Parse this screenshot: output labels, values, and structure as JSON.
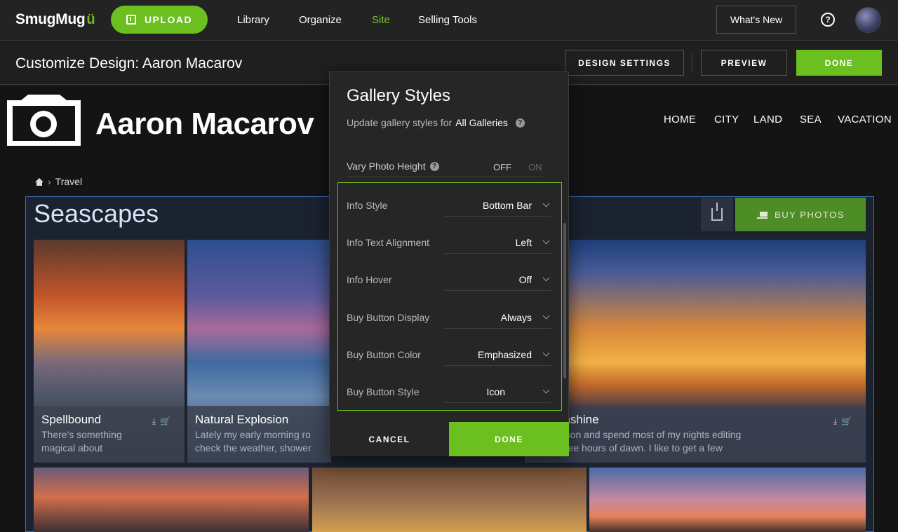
{
  "topbar": {
    "logo": "SmugMug",
    "upload_label": "UPLOAD",
    "nav": [
      "Library",
      "Organize",
      "Site",
      "Selling Tools"
    ],
    "active_nav": "Site",
    "whats_new": "What's New",
    "help": "?"
  },
  "subbar": {
    "title": "Customize Design: Aaron Macarov",
    "design_settings": "DESIGN SETTINGS",
    "preview": "PREVIEW",
    "done": "DONE"
  },
  "site": {
    "name": "Aaron Macarov",
    "nav": [
      "HOME",
      "CITY",
      "LAND",
      "SEA",
      "VACATION"
    ],
    "breadcrumb": "Travel",
    "gallery_title": "Seascapes",
    "buy_photos": "BUY PHOTOS",
    "photos": [
      {
        "title": "Spellbound",
        "desc1": "There's something",
        "desc2": "magical about"
      },
      {
        "title": "Natural Explosion",
        "desc1": "Lately my early morning ro",
        "desc2": "check the weather, shower"
      },
      {
        "title": "ng Sunshine",
        "desc1": "ight person and spend most of my nights editing",
        "desc2": "till the wee hours of dawn. I like to get a few"
      }
    ]
  },
  "modal": {
    "title": "Gallery Styles",
    "subtitle_prefix": "Update gallery styles for",
    "subtitle_target": "All Galleries",
    "vary_label": "Vary Photo Height",
    "toggle_off": "OFF",
    "toggle_on": "ON",
    "settings": [
      {
        "label": "Info Style",
        "value": "Bottom Bar"
      },
      {
        "label": "Info Text Alignment",
        "value": "Left"
      },
      {
        "label": "Info Hover",
        "value": "Off"
      },
      {
        "label": "Buy Button Display",
        "value": "Always"
      },
      {
        "label": "Buy Button Color",
        "value": "Emphasized"
      },
      {
        "label": "Buy Button Style",
        "value": "Icon"
      }
    ],
    "cancel": "CANCEL",
    "done": "DONE"
  },
  "colors": {
    "accent": "#6bbf1f",
    "gallery_border": "#3a6fb8"
  }
}
